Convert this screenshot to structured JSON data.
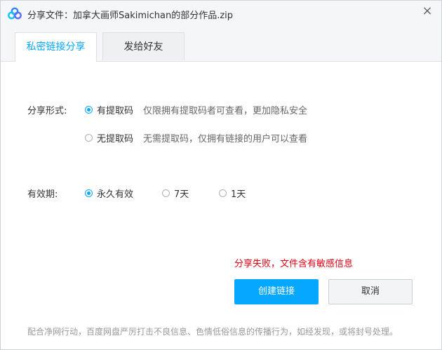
{
  "title": "分享文件：加拿大画师Sakimichan的部分作品.zip",
  "close_glyph": "×",
  "tabs": [
    {
      "label": "私密链接分享",
      "active": true
    },
    {
      "label": "发给好友",
      "active": false
    }
  ],
  "share_form": {
    "label": "分享形式:",
    "options": [
      {
        "label": "有提取码",
        "desc": "仅限拥有提取码者可查看，更加隐私安全",
        "checked": true
      },
      {
        "label": "无提取码",
        "desc": "无需提取码，仅拥有链接的用户可以查看",
        "checked": false
      }
    ]
  },
  "validity": {
    "label": "有效期:",
    "options": [
      {
        "label": "永久有效",
        "checked": true
      },
      {
        "label": "7天",
        "checked": false
      },
      {
        "label": "1天",
        "checked": false
      }
    ]
  },
  "error_message": "分享失败，文件含有敏感信息",
  "buttons": {
    "create": "创建链接",
    "cancel": "取消"
  },
  "footer_note": "配合净网行动，百度网盘严厉打击不良信息、色情低俗信息的传播行为，如经发现，或将封号处理。",
  "colors": {
    "accent": "#06a7ff",
    "error": "#e60012"
  },
  "icons": {
    "app": "baidu-netdisk-logo",
    "close": "close-icon"
  }
}
